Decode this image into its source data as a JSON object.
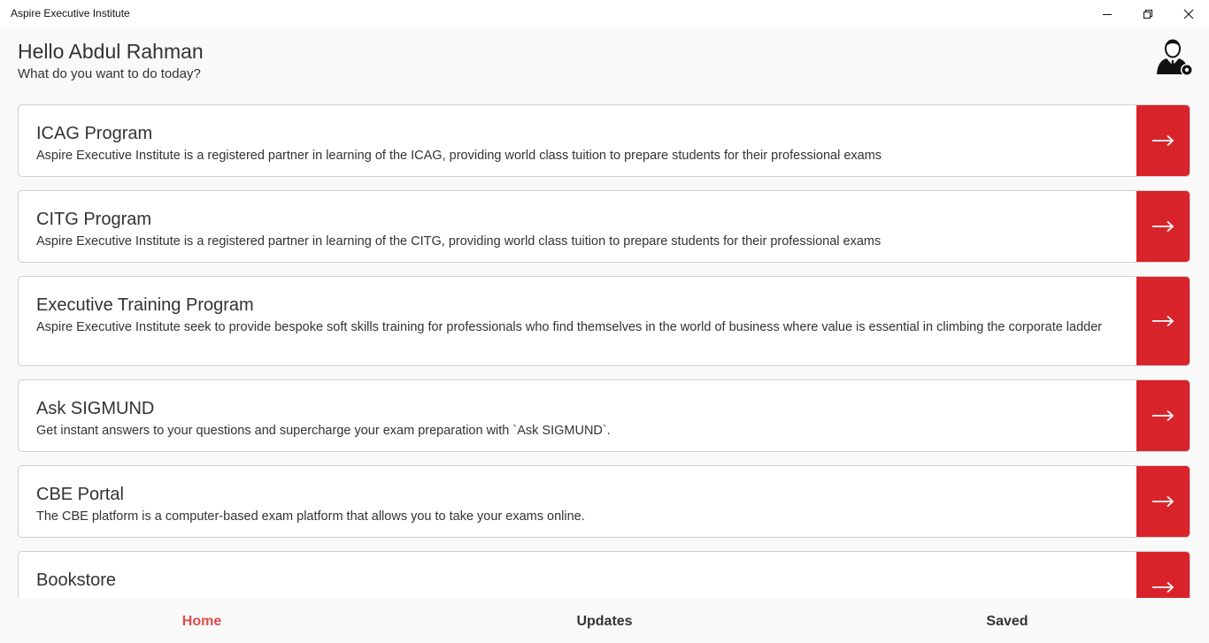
{
  "window": {
    "title": "Aspire Executive Institute",
    "controls": [
      "minimize-icon",
      "restore-icon",
      "close-icon"
    ]
  },
  "header": {
    "greeting": "Hello Abdul Rahman",
    "subtitle": "What do you want to do today?",
    "profile_icon": "user-settings-icon"
  },
  "cards": [
    {
      "title": "ICAG Program",
      "description": "Aspire Executive Institute  is a registered partner in learning of the ICAG, providing world class tuition to prepare students for their professional exams"
    },
    {
      "title": "CITG Program",
      "description": "Aspire Executive Institute  is a registered partner in learning of the CITG, providing world class tuition to prepare students for their professional exams"
    },
    {
      "title": "Executive Training Program",
      "description": "Aspire Executive Institute  seek to provide bespoke soft skills training for professionals who find themselves in the world of business where value is essential in climbing the corporate ladder"
    },
    {
      "title": "Ask SIGMUND",
      "description": "Get instant answers to your questions and supercharge your exam preparation with `Ask SIGMUND`."
    },
    {
      "title": "CBE Portal",
      "description": "The CBE platform is a computer-based exam platform that allows you to take your exams online."
    },
    {
      "title": "Bookstore",
      "description": ""
    }
  ],
  "card_action_icon": "arrow-right-icon",
  "colors": {
    "accent": "#d8232a",
    "nav_active": "#e04a4a"
  },
  "nav": {
    "home": "Home",
    "updates": "Updates",
    "saved": "Saved",
    "active": "Home"
  }
}
